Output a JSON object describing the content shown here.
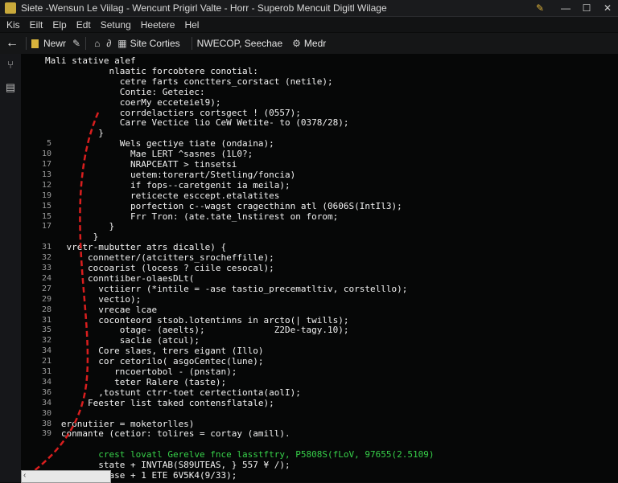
{
  "window": {
    "title": "Siete -Wensun Le  Viilag  - Wencunt Prigirl Valte - Horr - Superob Mencuit Digitl Wilage"
  },
  "menu": [
    "Kis",
    "Eilt",
    "Elp",
    "Edt",
    "Setung",
    "Heetere",
    "Hel"
  ],
  "toolbar": {
    "file_label": "Newr",
    "site_label": "Site Corties",
    "search_label": "NWECOP, Seechae",
    "mode_label": "Medr"
  },
  "code_lines": [
    {
      "n": "",
      "t": "Mali stative alef",
      "c": "code"
    },
    {
      "n": "",
      "t": "            nlaatic forcobtere conotial:",
      "c": "code"
    },
    {
      "n": "",
      "t": "              cetre farts conctters_corstact (netile);",
      "c": "code"
    },
    {
      "n": "",
      "t": "              Contie: Geteiec:",
      "c": "code"
    },
    {
      "n": "",
      "t": "              coerMy ecceteiel9);",
      "c": "code"
    },
    {
      "n": "",
      "t": "              corrdelactiers cortsgect ! (0557);",
      "c": "code"
    },
    {
      "n": "",
      "t": "              Carre Vectice lio CeW Wetite- to (0378/28);",
      "c": "mix1"
    },
    {
      "n": "",
      "t": "          }",
      "c": "code"
    },
    {
      "n": "5",
      "t": "              Wels gectiye tiate (ondaina);",
      "c": "code"
    },
    {
      "n": "10",
      "t": "                Mae LERT ^sasnes (1L0?;",
      "c": "code"
    },
    {
      "n": "17",
      "t": "                NRAPCEATT > tinsetsi",
      "c": "code"
    },
    {
      "n": "13",
      "t": "                uetem:torerart/Stetling/foncia)",
      "c": "code"
    },
    {
      "n": "12",
      "t": "                if fops--caretgenit ia meila);",
      "c": "code"
    },
    {
      "n": "19",
      "t": "                reticecte esccept.etalatites",
      "c": "code"
    },
    {
      "n": "15",
      "t": "                porfection c--wagst cragecthinn atl (0606S(IntIl3);",
      "c": "code"
    },
    {
      "n": "15",
      "t": "                Frr Tron: (ate.tate_lnstirest on forom;",
      "c": "code"
    },
    {
      "n": "17",
      "t": "            }",
      "c": "code"
    },
    {
      "n": "",
      "t": "         }",
      "c": "code"
    },
    {
      "n": "31",
      "t": "    vretr-mubutter atrs dicalle) {",
      "c": "code"
    },
    {
      "n": "32",
      "t": "        connetter/(atcitters_srocheffille);",
      "c": "code"
    },
    {
      "n": "33",
      "t": "        cocoarist (locess ? ciile cesocal);",
      "c": "code"
    },
    {
      "n": "24",
      "t": "        conntiiber-olaesDLt(",
      "c": "code"
    },
    {
      "n": "27",
      "t": "          vctiierr (*intile = -ase tastio_precematltiv, corstelllo);",
      "c": "code"
    },
    {
      "n": "29",
      "t": "          vectio);",
      "c": "code"
    },
    {
      "n": "28",
      "t": "          vrecae lcae",
      "c": "code"
    },
    {
      "n": "31",
      "t": "          coconteord stsob.lotentinns in arcto(| twills);",
      "c": "mix2"
    },
    {
      "n": "35",
      "t": "              otage- (aeelts);             Z2De-tagy.10);",
      "c": "code"
    },
    {
      "n": "32",
      "t": "              saclie (atcul);",
      "c": "code"
    },
    {
      "n": "34",
      "t": "          Core slaes, trers eigant (Illo)",
      "c": "code"
    },
    {
      "n": "21",
      "t": "          cor cetorilo( asgoCentec(lune);",
      "c": "code"
    },
    {
      "n": "31",
      "t": "             rncoertobol - (pnstan);",
      "c": "code"
    },
    {
      "n": "34",
      "t": "             teter Ralere (taste);",
      "c": "code"
    },
    {
      "n": "36",
      "t": "          ,tostunt ctrr-toet certectionta(aolI);",
      "c": "mix3"
    },
    {
      "n": "34",
      "t": "        Feester list taked contensflatale);",
      "c": "code"
    },
    {
      "n": "30",
      "t": "",
      "c": "code"
    },
    {
      "n": "38",
      "t": "   eronutiier = moketorlles)",
      "c": "code"
    },
    {
      "n": "39",
      "t": "   conmante (cetior: tolires = cortay (amill).",
      "c": "mix4"
    },
    {
      "n": "",
      "t": "",
      "c": "code"
    },
    {
      "n": "",
      "t": "          crest lovatl Gerelve fnce lasstftry, P5808S(fLoV, 97655(2.5109)",
      "c": "green"
    },
    {
      "n": "",
      "t": "          state + INVTAB(S89UTEAS, } 557 ¥ /);",
      "c": "code"
    },
    {
      "n": "",
      "t": "          sease + 1 ETE 6V5K4(9/33);",
      "c": "code"
    }
  ]
}
